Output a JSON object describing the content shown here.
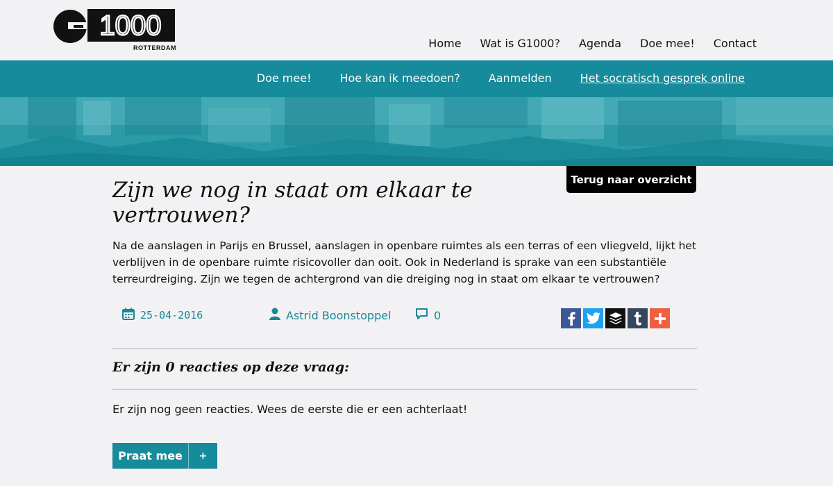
{
  "logo": {
    "text": "G1000",
    "subtitle": "ROTTERDAM"
  },
  "main_nav": [
    {
      "label": "Home"
    },
    {
      "label": "Wat is G1000?"
    },
    {
      "label": "Agenda"
    },
    {
      "label": "Doe mee!"
    },
    {
      "label": "Contact"
    }
  ],
  "sub_nav": [
    {
      "label": "Doe mee!"
    },
    {
      "label": "Hoe kan ik meedoen?"
    },
    {
      "label": "Aanmelden"
    },
    {
      "label": "Het socratisch gesprek online",
      "active": true
    }
  ],
  "back_button": "Terug naar overzicht",
  "article": {
    "title": "Zijn we nog in staat om elkaar te vertrouwen?",
    "intro": "Na de aanslagen in Parijs en Brussel, aanslagen in openbare ruimtes als een terras of een vliegveld, lijkt het verblijven in de openbare ruimte risicovoller dan ooit. Ook in Nederland is sprake van een substantiële terreurdreiging. Zijn we tegen de achtergrond van die dreiging nog in staat om elkaar te vertrouwen?",
    "date": "25-04-2016",
    "author": "Astrid Boonstoppel",
    "comments": "0"
  },
  "share": [
    {
      "icon": "facebook-icon",
      "color": "#3b5998"
    },
    {
      "icon": "twitter-icon",
      "color": "#1da1f2"
    },
    {
      "icon": "buffer-icon",
      "color": "#111111"
    },
    {
      "icon": "tumblr-icon",
      "color": "#35465c"
    },
    {
      "icon": "plus-icon",
      "color": "#f05f40"
    }
  ],
  "reactions_heading": "Er zijn 0 reacties op deze vraag:",
  "no_reactions": "Er zijn nog geen reacties. Wees de eerste die er een achterlaat!",
  "praat_button": {
    "label": "Praat mee",
    "plus": "+"
  },
  "colors": {
    "teal": "#168b9b",
    "meta_teal": "#1c8696",
    "background": "#f2f2f4"
  }
}
